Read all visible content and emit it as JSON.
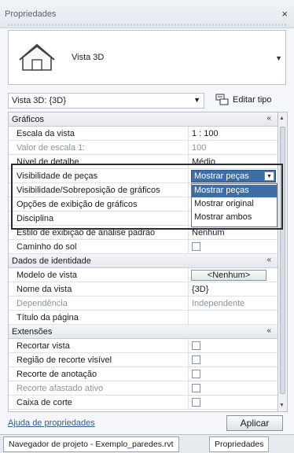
{
  "window": {
    "title": "Propriedades",
    "close_label": "×"
  },
  "type_selector": {
    "name": "Vista 3D",
    "icon": "house-3d-icon"
  },
  "instance": {
    "selector_value": "Vista 3D: {3D}",
    "edit_type_label": "Editar tipo"
  },
  "categories": {
    "graphics": "Gráficos",
    "identity": "Dados de identidade",
    "extents": "Extensões"
  },
  "graphics_rows": [
    {
      "name": "Escala da vista",
      "value": "1 : 100"
    },
    {
      "name": "Valor de escala    1:",
      "value": "100"
    },
    {
      "name": "Nível de detalhe",
      "value": "Médio"
    },
    {
      "name": "Visibilidade de peças",
      "value": "Mostrar peças"
    },
    {
      "name": "Visibilidade/Sobreposição de gráficos",
      "value": ""
    },
    {
      "name": "Opções de exibição de gráficos",
      "value": ""
    },
    {
      "name": "Disciplina",
      "value": ""
    },
    {
      "name": "Estilo de exibição de análise padrão",
      "value": "Nenhum"
    },
    {
      "name": "Caminho do sol",
      "value": ""
    }
  ],
  "parts_dropdown": {
    "selected": "Mostrar peças",
    "options": [
      "Mostrar peças",
      "Mostrar original",
      "Mostrar ambos"
    ]
  },
  "identity_rows": [
    {
      "name": "Modelo de vista",
      "value": "<Nenhum>"
    },
    {
      "name": "Nome da vista",
      "value": "{3D}"
    },
    {
      "name": "Dependência",
      "value": "Independente"
    },
    {
      "name": "Título da página",
      "value": ""
    }
  ],
  "extents_rows": [
    {
      "name": "Recortar vista",
      "value": ""
    },
    {
      "name": "Região de recorte visível",
      "value": ""
    },
    {
      "name": "Recorte de anotação",
      "value": ""
    },
    {
      "name": "Recorte afastado ativo",
      "value": ""
    },
    {
      "name": "Caixa de corte",
      "value": ""
    }
  ],
  "footer": {
    "help_link": "Ajuda de propriedades",
    "apply_label": "Aplicar"
  },
  "tabs": [
    "Navegador de projeto - Exemplo_paredes.rvt",
    "Propriedades"
  ],
  "colors": {
    "selection": "#3d6ea8",
    "link": "#345c8f"
  }
}
